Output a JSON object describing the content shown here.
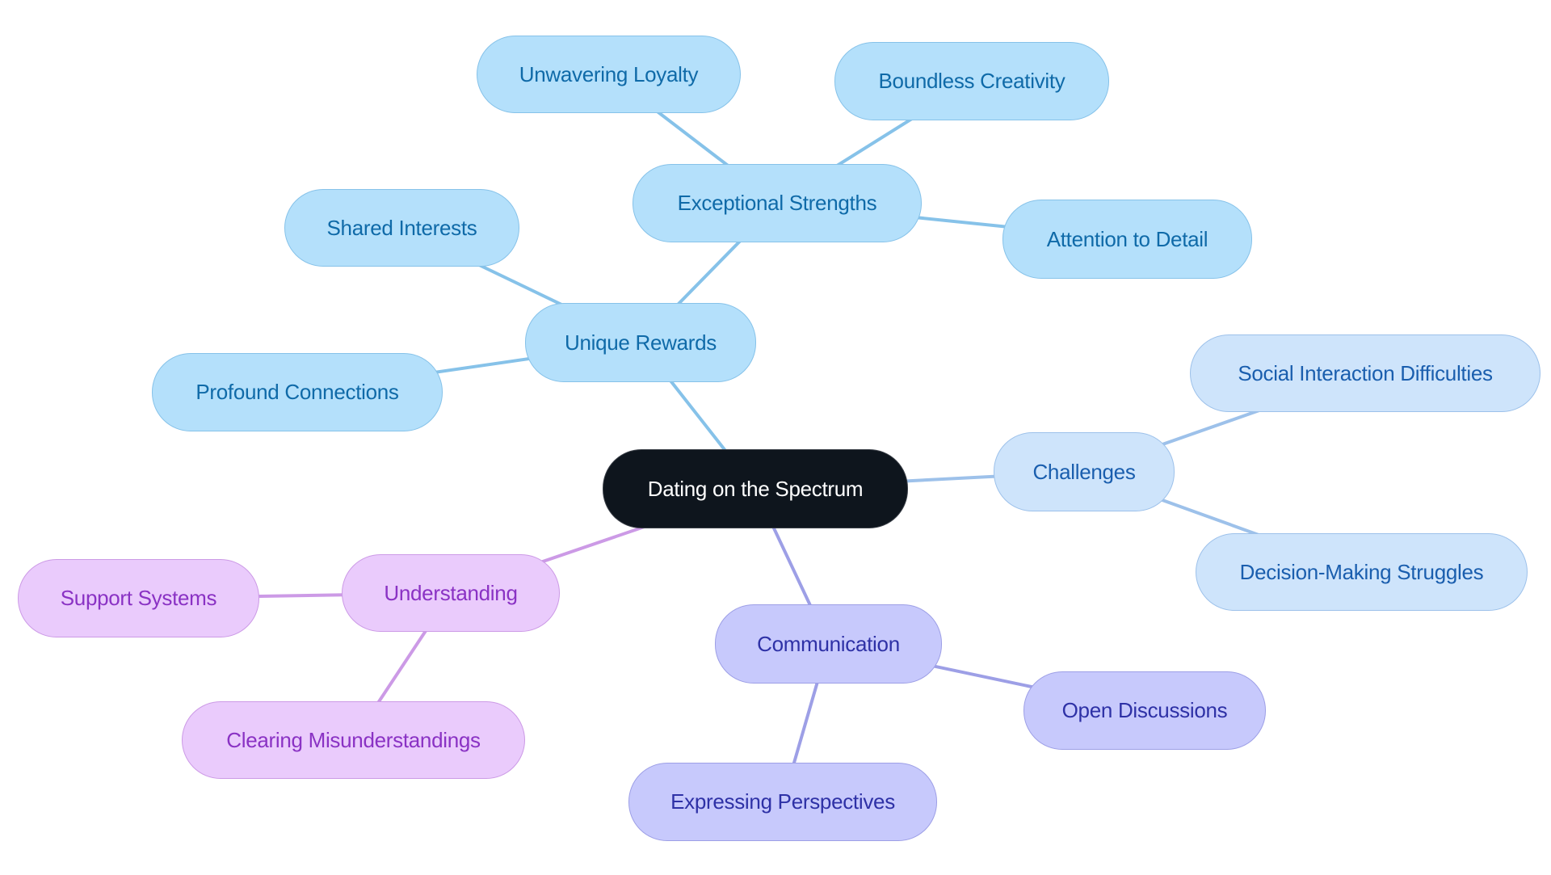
{
  "diagram": {
    "type": "mindmap",
    "root": "Dating on the Spectrum",
    "colors": {
      "root_fill": "#0e151d",
      "rewards_fill": "#b4e0fb",
      "rewards_text": "#0f6aa8",
      "rewards_edge": "#86c2e9",
      "challenges_fill": "#cee4fb",
      "challenges_text": "#1a5eae",
      "challenges_edge": "#9dc1ea",
      "understanding_fill": "#eacbfc",
      "understanding_text": "#8a32c4",
      "understanding_edge": "#cc9ae6",
      "communication_fill": "#c7c9fc",
      "communication_text": "#2e31a6",
      "communication_edge": "#9d9fe6"
    },
    "nodes": {
      "root": "Dating on the Spectrum",
      "unique_rewards": "Unique Rewards",
      "exceptional_strengths": "Exceptional Strengths",
      "unwavering_loyalty": "Unwavering Loyalty",
      "boundless_creativity": "Boundless Creativity",
      "attention_to_detail": "Attention to Detail",
      "shared_interests": "Shared Interests",
      "profound_connections": "Profound Connections",
      "challenges": "Challenges",
      "social_interaction": "Social Interaction Difficulties",
      "decision_making": "Decision-Making Struggles",
      "understanding": "Understanding",
      "support_systems": "Support Systems",
      "clearing_misunderstandings": "Clearing Misunderstandings",
      "communication": "Communication",
      "open_discussions": "Open Discussions",
      "expressing_perspectives": "Expressing Perspectives"
    },
    "edges": [
      {
        "from": "root",
        "to": "unique_rewards",
        "branch": "rewards"
      },
      {
        "from": "unique_rewards",
        "to": "exceptional_strengths",
        "branch": "rewards"
      },
      {
        "from": "exceptional_strengths",
        "to": "unwavering_loyalty",
        "branch": "rewards"
      },
      {
        "from": "exceptional_strengths",
        "to": "boundless_creativity",
        "branch": "rewards"
      },
      {
        "from": "exceptional_strengths",
        "to": "attention_to_detail",
        "branch": "rewards"
      },
      {
        "from": "unique_rewards",
        "to": "shared_interests",
        "branch": "rewards"
      },
      {
        "from": "unique_rewards",
        "to": "profound_connections",
        "branch": "rewards"
      },
      {
        "from": "root",
        "to": "challenges",
        "branch": "challenges"
      },
      {
        "from": "challenges",
        "to": "social_interaction",
        "branch": "challenges"
      },
      {
        "from": "challenges",
        "to": "decision_making",
        "branch": "challenges"
      },
      {
        "from": "root",
        "to": "understanding",
        "branch": "understanding"
      },
      {
        "from": "understanding",
        "to": "support_systems",
        "branch": "understanding"
      },
      {
        "from": "understanding",
        "to": "clearing_misunderstandings",
        "branch": "understanding"
      },
      {
        "from": "root",
        "to": "communication",
        "branch": "communication"
      },
      {
        "from": "communication",
        "to": "open_discussions",
        "branch": "communication"
      },
      {
        "from": "communication",
        "to": "expressing_perspectives",
        "branch": "communication"
      }
    ]
  }
}
